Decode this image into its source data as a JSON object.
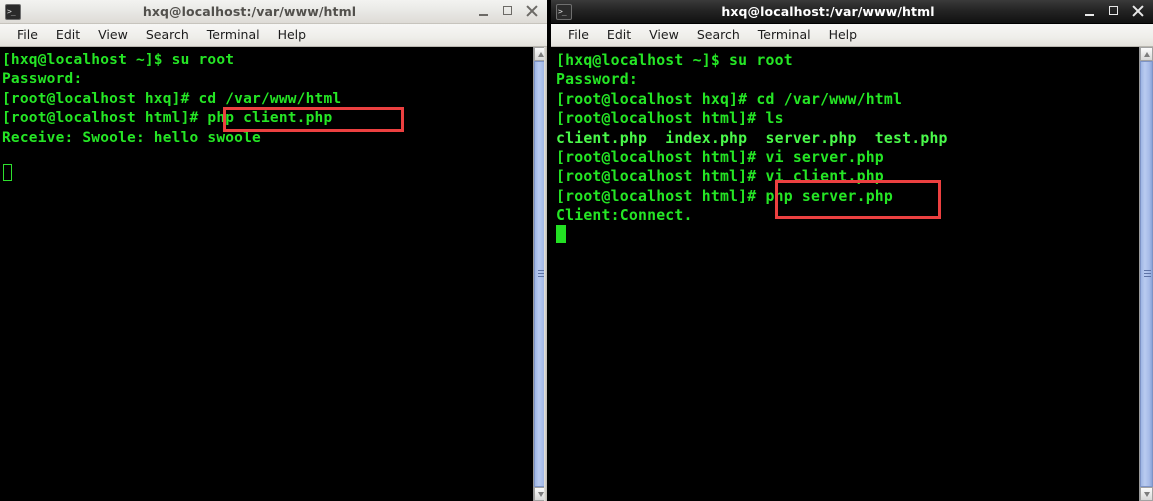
{
  "windows": [
    {
      "id": "left",
      "focused": false,
      "title": "hxq@localhost:/var/www/html",
      "icon": "terminal-icon",
      "menu": [
        "File",
        "Edit",
        "View",
        "Search",
        "Terminal",
        "Help"
      ],
      "buttons": {
        "minimize": "minimize-icon",
        "maximize": "maximize-icon",
        "close": "close-icon"
      },
      "lines": [
        "[hxq@localhost ~]$ su root",
        "Password:",
        "[root@localhost hxq]# cd /var/www/html",
        "[root@localhost html]# php client.php",
        "Receive: Swoole: hello swoole"
      ],
      "cursor": "hollow",
      "highlight": "php client.php"
    },
    {
      "id": "right",
      "focused": true,
      "title": "hxq@localhost:/var/www/html",
      "icon": "terminal-icon",
      "menu": [
        "File",
        "Edit",
        "View",
        "Search",
        "Terminal",
        "Help"
      ],
      "buttons": {
        "minimize": "minimize-icon",
        "maximize": "maximize-icon",
        "close": "close-icon"
      },
      "lines": [
        "[hxq@localhost ~]$ su root",
        "Password:",
        "[root@localhost hxq]# cd /var/www/html",
        "[root@localhost html]# ls",
        "client.php  index.php  server.php  test.php",
        "[root@localhost html]# vi server.php",
        "[root@localhost html]# vi client.php",
        "[root@localhost html]# php server.php",
        "Client:Connect."
      ],
      "cursor": "solid",
      "highlight": "php server.php"
    }
  ],
  "colors": {
    "terminal_background": "#000000",
    "terminal_text": "#25e625",
    "terminal_text_bright": "#4af94a",
    "annotation_box": "#ec4040",
    "titlebar_active": "#1a1a1a",
    "titlebar_inactive": "#e9e9e6",
    "scrollbar_thumb": "#a6bbe8"
  }
}
